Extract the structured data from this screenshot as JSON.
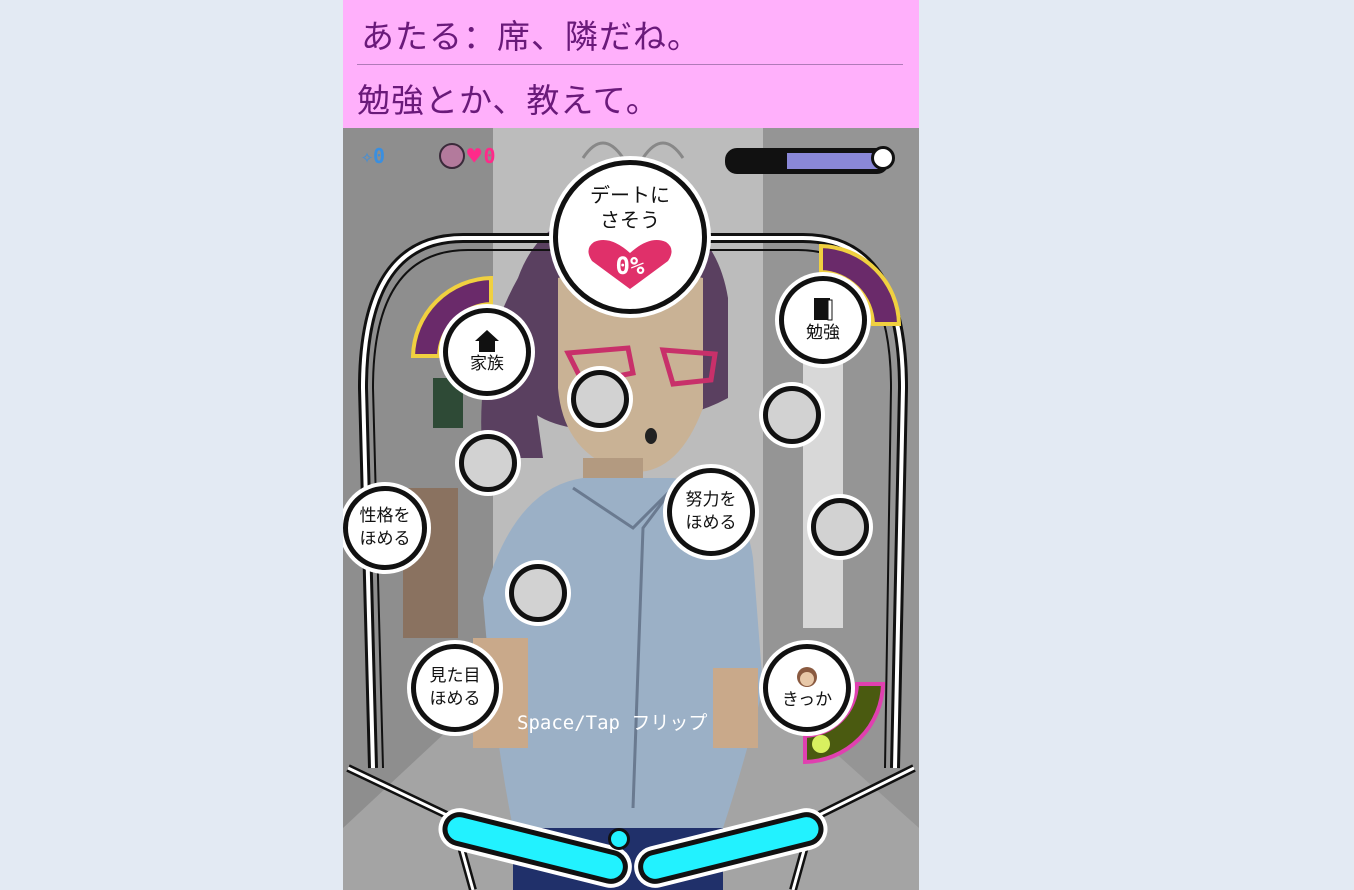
{
  "dialog": {
    "line1": "あたる：席、隣だね。",
    "line2": "勉強とか、教えて。"
  },
  "hud": {
    "sparkle_icon": "sparkle-icon",
    "sparkle_count": "0",
    "affection_count": "0",
    "time_remaining": 0.6
  },
  "bubbles": {
    "date": {
      "line1": "デートに",
      "line2": "さそう",
      "percent": "0%"
    },
    "study": "勉強",
    "family": "家族",
    "personality": {
      "line1": "性格を",
      "line2": "ほめる"
    },
    "effort": {
      "line1": "努力を",
      "line2": "ほめる"
    },
    "looks": {
      "line1": "見た目",
      "line2": "ほめる"
    },
    "trigger": "きっか"
  },
  "hint": "Space/Tap  フリップ",
  "colors": {
    "dialog_bg": "#ffb0fb",
    "dialog_text": "#6a1a7a",
    "heart": "#e0306a",
    "flipper": "#22f2ff",
    "gauge": "#6a2a6a"
  }
}
